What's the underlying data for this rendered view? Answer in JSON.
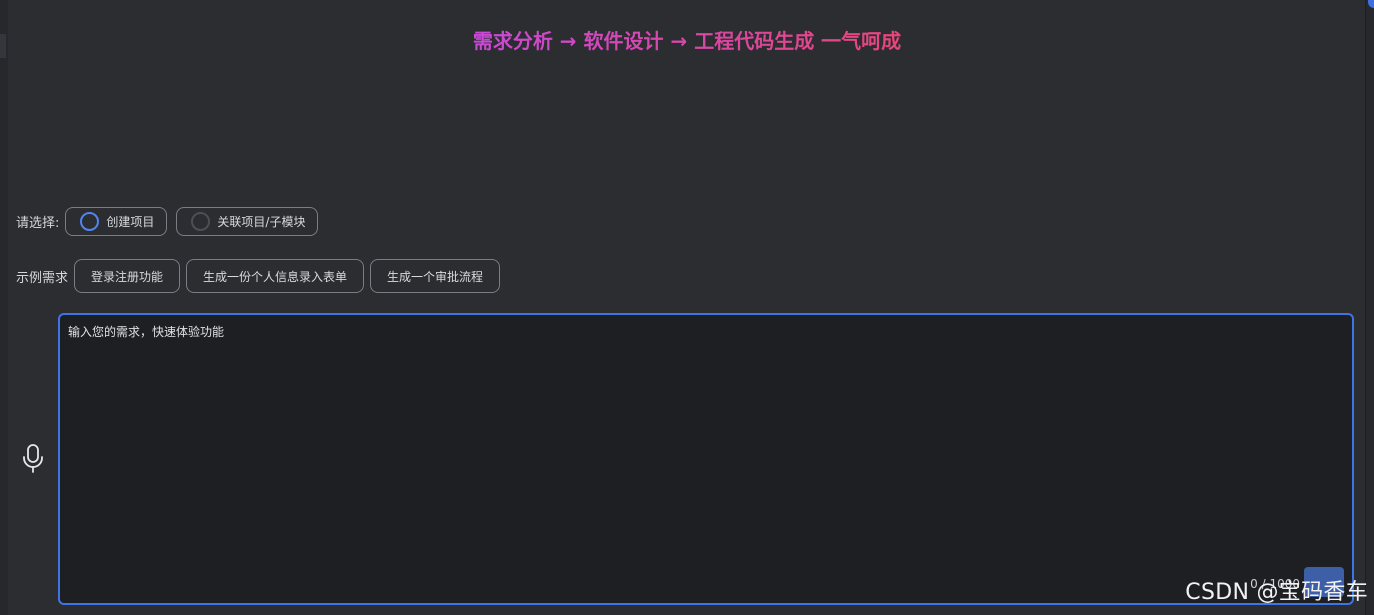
{
  "header": {
    "headline": "需求分析 → 软件设计 → 工程代码生成 一气呵成"
  },
  "mode_select": {
    "label": "请选择:",
    "options": [
      {
        "label": "创建项目",
        "selected": true
      },
      {
        "label": "关联项目/子模块",
        "selected": false
      }
    ]
  },
  "examples": {
    "label": "示例需求",
    "items": [
      "登录注册功能",
      "生成一份个人信息录入表单",
      "生成一个审批流程"
    ]
  },
  "input": {
    "placeholder": "输入您的需求，快速体验功能",
    "counter": "0 / 1000"
  },
  "icons": {
    "voice": "microphone-icon",
    "send": "send-icon"
  },
  "colors": {
    "accent": "#3d74e6",
    "headline_start": "#c84ad6",
    "headline_end": "#e8457a"
  },
  "watermark": "CSDN @宝码香车"
}
